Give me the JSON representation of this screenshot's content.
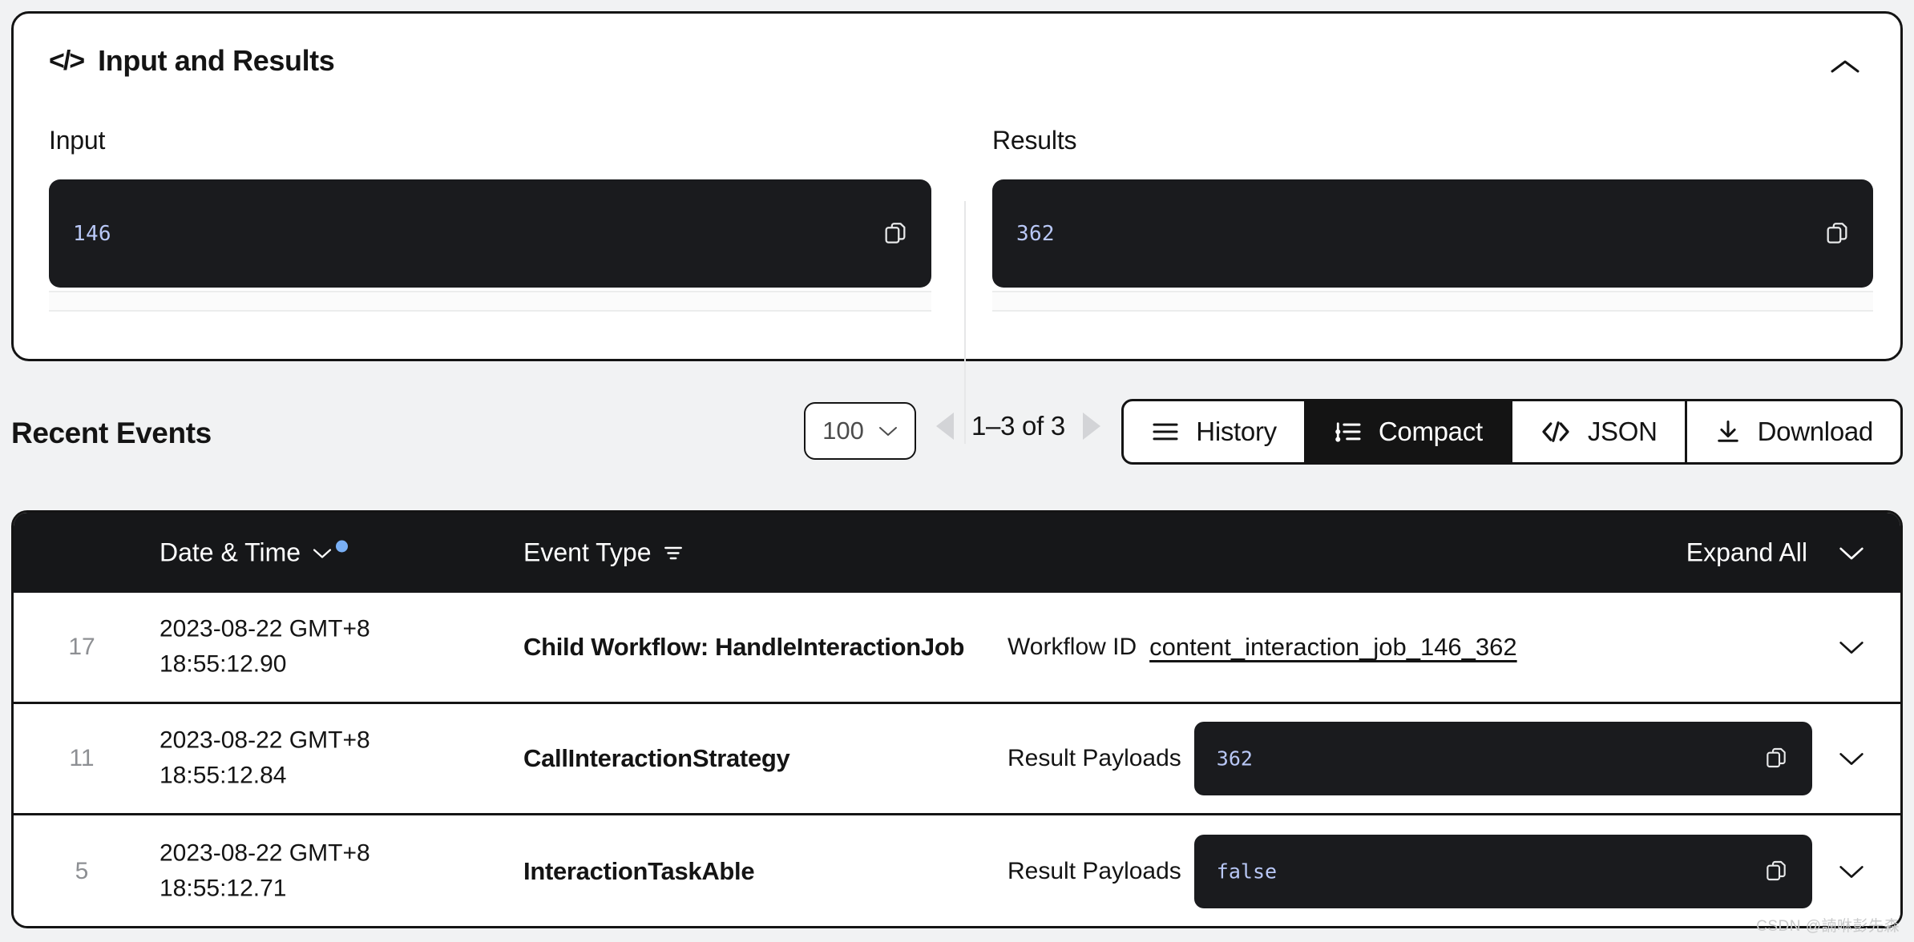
{
  "io_card": {
    "title": "Input and Results",
    "code_glyph": "</>",
    "collapse_icon": "chevron-up-icon",
    "input": {
      "label": "Input",
      "value": "146",
      "copy_icon": "copy-icon"
    },
    "results": {
      "label": "Results",
      "value": "362",
      "copy_icon": "copy-icon"
    }
  },
  "events": {
    "title": "Recent Events",
    "page_size": "100",
    "pager_label": "1–3 of 3",
    "prev_icon": "triangle-left-icon",
    "next_icon": "triangle-right-icon",
    "view_buttons": [
      {
        "label": "History",
        "icon": "list-lines-icon",
        "active": false
      },
      {
        "label": "Compact",
        "icon": "tree-list-icon",
        "active": true
      },
      {
        "label": "JSON",
        "icon": "code-brackets-icon",
        "active": false
      },
      {
        "label": "Download",
        "icon": "download-arrow-icon",
        "active": false
      }
    ],
    "columns": {
      "date_time": "Date & Time",
      "event_type": "Event Type",
      "expand_all": "Expand All"
    },
    "rows": [
      {
        "id": "17",
        "date": "2023-08-22 GMT+8\n18:55:12.90",
        "type": "Child Workflow: HandleInteractionJob",
        "detail_label": "Workflow ID",
        "detail_link": "content_interaction_job_146_362",
        "detail_code": null
      },
      {
        "id": "11",
        "date": "2023-08-22 GMT+8\n18:55:12.84",
        "type": "CallInteractionStrategy",
        "detail_label": "Result Payloads",
        "detail_link": null,
        "detail_code": "362"
      },
      {
        "id": "5",
        "date": "2023-08-22 GMT+8\n18:55:12.71",
        "type": "InteractionTaskAble",
        "detail_label": "Result Payloads",
        "detail_link": null,
        "detail_code": "false"
      }
    ]
  },
  "watermark": "CSDN @諵咻彭先森",
  "colors": {
    "accent_blue": "#79b0f6",
    "code_text": "#b9c8f7",
    "code_bg": "#1a1b1e",
    "ink": "#141414",
    "page_bg": "#f1f2f3"
  }
}
